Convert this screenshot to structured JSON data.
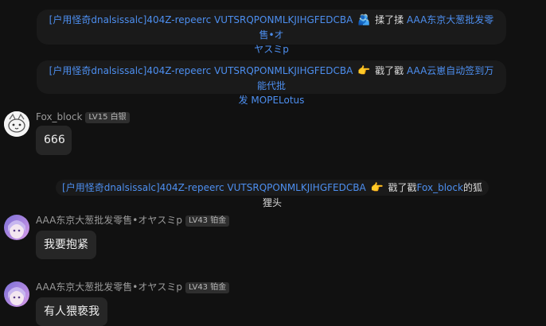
{
  "messages": {
    "sys1": {
      "name_line1": "[户用怪奇dnalsissalc]404Z-repeerc VUTSRQPONMLKJIHGFEDCBA",
      "emoji": "🫂",
      "action": "揉了揉",
      "target_line1": "AAA东京大葱批发零售•オ",
      "target_line2": "ヤスミp"
    },
    "sys2": {
      "name": "[户用怪奇dnalsissalc]404Z-repeerc VUTSRQPONMLKJIHGFEDCBA",
      "emoji": "👉",
      "action": "戳了戳",
      "target_line1": "AAA云崽自动签到万能代批",
      "target_line2": "发 MOPELotus"
    },
    "msg1": {
      "sender": "Fox_block",
      "level": "LV15 白银",
      "text": "666"
    },
    "sys3": {
      "name": "[户用怪奇dnalsissalc]404Z-repeerc VUTSRQPONMLKJIHGFEDCBA",
      "emoji": "👉",
      "action": "戳了戳",
      "target": "Fox_block",
      "suffix": "的狐狸头"
    },
    "msg2": {
      "sender": "AAA东京大葱批发零售•オヤスミp",
      "level": "LV43 铂金",
      "text": "我要抱紧"
    },
    "msg3": {
      "sender": "AAA东京大葱批发零售•オヤスミp",
      "level": "LV43 铂金",
      "text": "有人猥亵我"
    }
  }
}
